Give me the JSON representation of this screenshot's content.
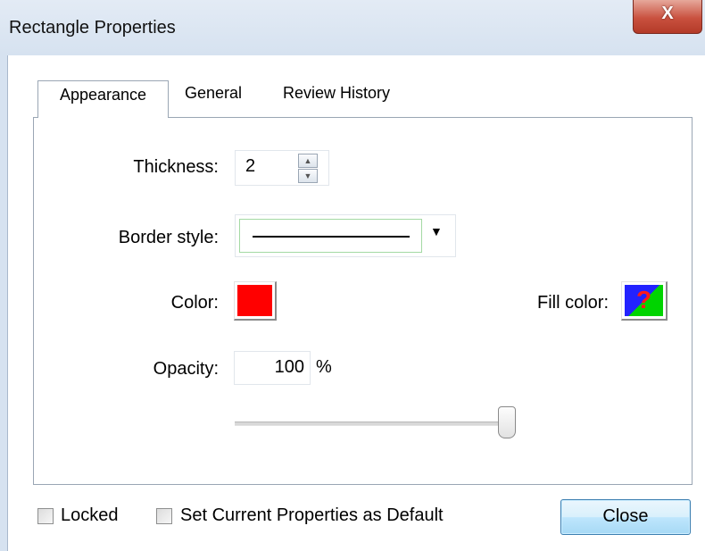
{
  "window": {
    "title": "Rectangle Properties",
    "close_glyph": "X"
  },
  "tabs": [
    {
      "label": "Appearance",
      "active": true
    },
    {
      "label": "General",
      "active": false
    },
    {
      "label": "Review History",
      "active": false
    }
  ],
  "appearance": {
    "thickness_label": "Thickness:",
    "thickness_value": "2",
    "border_style_label": "Border style:",
    "border_style_value": "solid-line",
    "color_label": "Color:",
    "color_value": "#ff0000",
    "fill_color_label": "Fill color:",
    "fill_color_value": "none",
    "fill_color_glyph": "?",
    "opacity_label": "Opacity:",
    "opacity_value": "100",
    "opacity_unit": "%",
    "opacity_slider_fraction": 1.0
  },
  "footer": {
    "locked_label": "Locked",
    "locked_checked": false,
    "default_label": "Set Current Properties as Default",
    "default_checked": false,
    "close_label": "Close"
  },
  "icons": {
    "spin_up": "up-arrow-icon",
    "spin_down": "down-arrow-icon",
    "dropdown": "chevron-down-icon",
    "fill_unknown": "question-mark-icon"
  }
}
